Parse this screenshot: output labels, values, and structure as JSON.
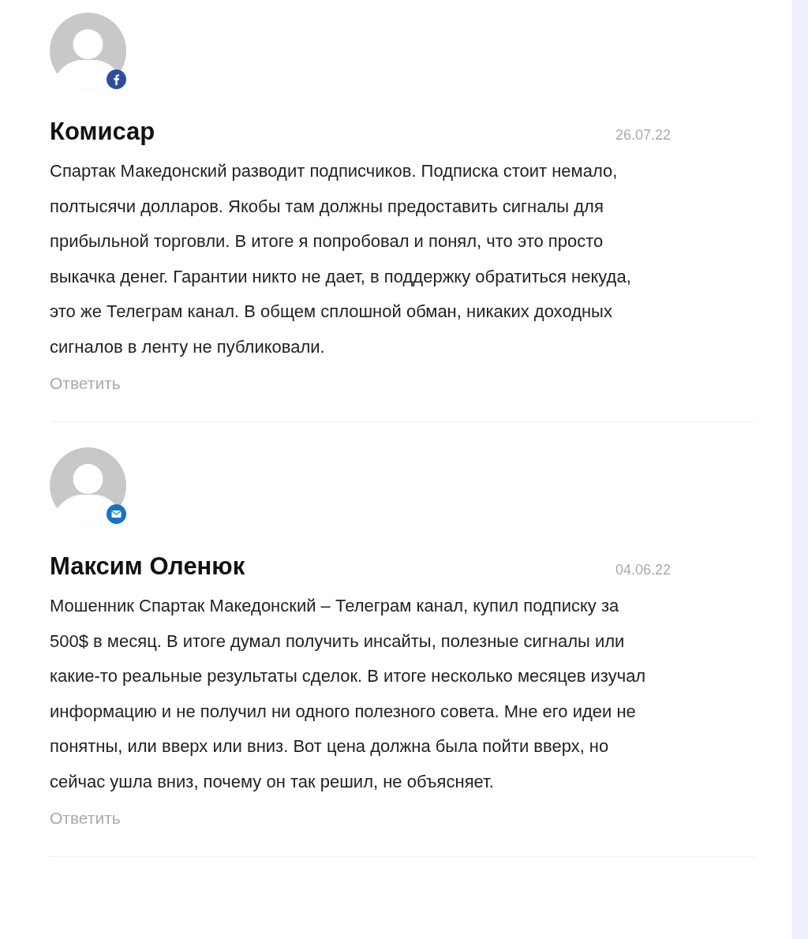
{
  "comments": [
    {
      "kind": "facebook",
      "author": "Комисар",
      "date": "26.07.22",
      "text": "Спартак Македонский разводит подписчиков. Подписка стоит немало, полтысячи долларов. Якобы там должны предоставить сигналы для прибыльной торговли. В итоге я попробовал и понял, что это просто выкачка денег. Гарантии никто не дает, в поддержку обратиться некуда, это же Телеграм канал. В общем сплошной обман, никаких доходных сигналов в ленту не публиковали.",
      "reply": "Ответить"
    },
    {
      "kind": "email",
      "author": "Максим Оленюк",
      "date": "04.06.22",
      "text": "Мошенник Спартак Македонский – Телеграм канал, купил подписку за 500$ в месяц. В итоге думал получить инсайты, полезные сигналы или какие-то реальные результаты сделок. В итоге несколько месяцев изучал информацию и не получил ни одного полезного совета. Мне его идеи не понятны, или вверх или вниз. Вот цена должна была пойти вверх, но сейчас ушла вниз, почему он так решил, не объясняет.",
      "reply": "Ответить"
    }
  ]
}
